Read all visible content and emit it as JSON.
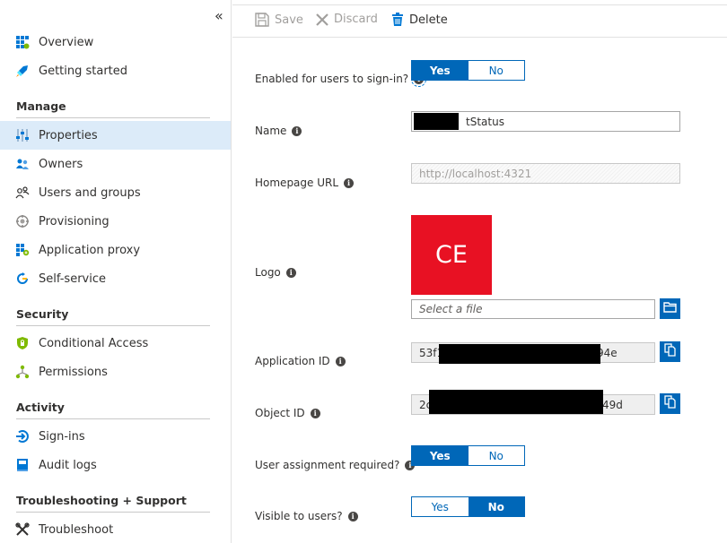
{
  "sidebar": {
    "collapse_glyph": "«",
    "items_top": [
      {
        "label": "Overview",
        "icon": "overview-grid-icon"
      },
      {
        "label": "Getting started",
        "icon": "rocket-icon"
      }
    ],
    "manage_header": "Manage",
    "manage_items": [
      {
        "label": "Properties",
        "icon": "properties-sliders-icon",
        "selected": true
      },
      {
        "label": "Owners",
        "icon": "owners-people-icon"
      },
      {
        "label": "Users and groups",
        "icon": "users-groups-icon"
      },
      {
        "label": "Provisioning",
        "icon": "provisioning-icon"
      },
      {
        "label": "Application proxy",
        "icon": "application-proxy-icon"
      },
      {
        "label": "Self-service",
        "icon": "self-service-icon"
      }
    ],
    "security_header": "Security",
    "security_items": [
      {
        "label": "Conditional Access",
        "icon": "shield-icon"
      },
      {
        "label": "Permissions",
        "icon": "permissions-tree-icon"
      }
    ],
    "activity_header": "Activity",
    "activity_items": [
      {
        "label": "Sign-ins",
        "icon": "sign-in-arrow-icon"
      },
      {
        "label": "Audit logs",
        "icon": "audit-log-book-icon"
      }
    ],
    "support_header": "Troubleshooting + Support",
    "support_items": [
      {
        "label": "Troubleshoot",
        "icon": "wrench-icon"
      }
    ]
  },
  "toolbar": {
    "save_label": "Save",
    "discard_label": "Discard",
    "delete_label": "Delete"
  },
  "form": {
    "enabled_label": "Enabled for users to sign-in?",
    "enabled_yes": "Yes",
    "enabled_no": "No",
    "enabled_value": "Yes",
    "name_label": "Name",
    "name_value": "tStatus",
    "homepage_label": "Homepage URL",
    "homepage_value": "http://localhost:4321",
    "logo_label": "Logo",
    "logo_initials": "CE",
    "file_placeholder": "Select a file",
    "app_id_label": "Application ID",
    "app_id_prefix": "53f1",
    "app_id_suffix": "94e",
    "object_id_label": "Object ID",
    "object_id_prefix": "2c",
    "object_id_suffix": "49d",
    "assignment_label": "User assignment required?",
    "assignment_yes": "Yes",
    "assignment_no": "No",
    "assignment_value": "Yes",
    "visible_label": "Visible to users?",
    "visible_yes": "Yes",
    "visible_no": "No",
    "visible_value": "No"
  },
  "colors": {
    "accent": "#0067b8",
    "selected_nav": "#dcebf9",
    "logo_bg": "#e81123",
    "redaction": "#000000"
  }
}
